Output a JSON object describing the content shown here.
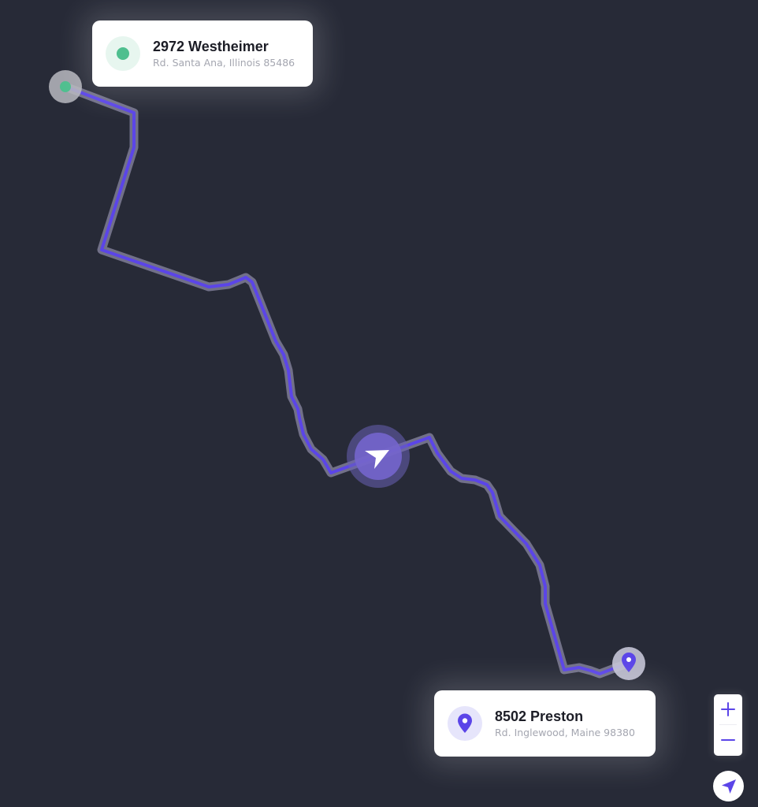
{
  "map": {
    "background_color": "#272a37",
    "route_color": "#5b45e8",
    "route_halo_color": "#7f7d97",
    "origin_color": "#4fbf8f",
    "destination_color": "#5b45e8"
  },
  "origin": {
    "title": "2972 Westheimer",
    "subtitle": "Rd. Santa Ana, Illinois 85486",
    "icon": "green-dot-icon"
  },
  "destination": {
    "title": "8502 Preston",
    "subtitle": "Rd. Inglewood, Maine 98380",
    "icon": "location-pin-icon"
  },
  "current_position": {
    "icon": "navigation-arrow-icon"
  },
  "controls": {
    "zoom_in_icon": "plus-icon",
    "zoom_out_icon": "minus-icon",
    "locate_icon": "navigation-arrow-icon"
  }
}
